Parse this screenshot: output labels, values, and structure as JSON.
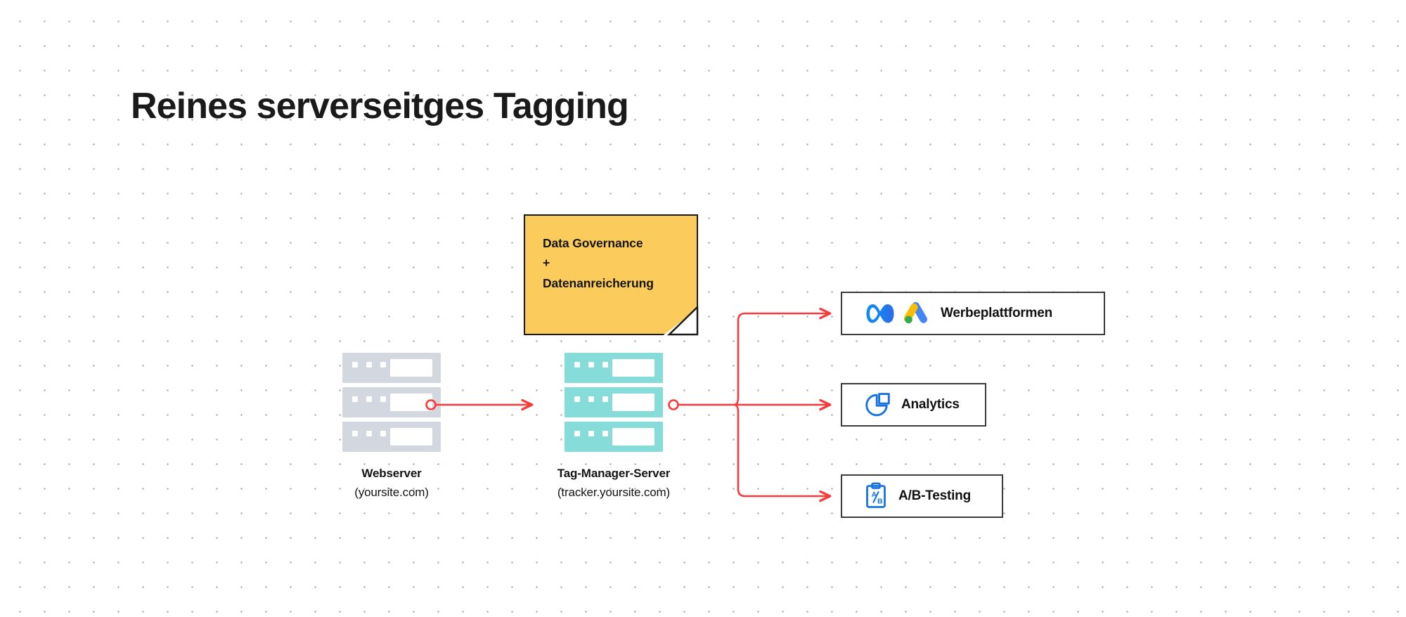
{
  "page": {
    "title": "Reines serverseitges Tagging",
    "background": "#ffffff",
    "dot_grid_color": "#9aa0a6",
    "accent_arrow_color": "#fb3b3b"
  },
  "note": {
    "name": "data-governance-note",
    "line1": "Data Governance",
    "line2": "+",
    "line3": "Datenanreicherung",
    "fill": "#fbcc5c",
    "border": "#1a1a1a"
  },
  "nodes": {
    "webserver": {
      "name": "Webserver",
      "host": "(yoursite.com)",
      "color": "#d3d8e0"
    },
    "tag_manager": {
      "name": "Tag-Manager-Server",
      "host": "(tracker.yoursite.com)",
      "color": "#86dcd8"
    }
  },
  "destinations": [
    {
      "label": "Werbeplattformen",
      "icons": [
        "meta-logo-icon",
        "google-ads-logo-icon"
      ],
      "colors": {
        "meta": "#1b7fef",
        "ads_yellow": "#fabc05",
        "ads_blue": "#4285f4",
        "ads_green": "#34a853"
      }
    },
    {
      "label": "Analytics",
      "icons": [
        "pie-chart-icon"
      ],
      "colors": {
        "icon": "#1773e0"
      }
    },
    {
      "label": "A/B-Testing",
      "icons": [
        "clipboard-ab-icon"
      ],
      "colors": {
        "icon": "#1773e0"
      },
      "icon_text": {
        "a": "A",
        "b": "B"
      }
    }
  ],
  "connections": [
    {
      "from": "Webserver",
      "to": "Tag-Manager-Server",
      "style": "arrow"
    },
    {
      "from": "Tag-Manager-Server",
      "to": "Werbeplattformen",
      "style": "arrow"
    },
    {
      "from": "Tag-Manager-Server",
      "to": "Analytics",
      "style": "arrow"
    },
    {
      "from": "Tag-Manager-Server",
      "to": "A/B-Testing",
      "style": "arrow"
    }
  ]
}
